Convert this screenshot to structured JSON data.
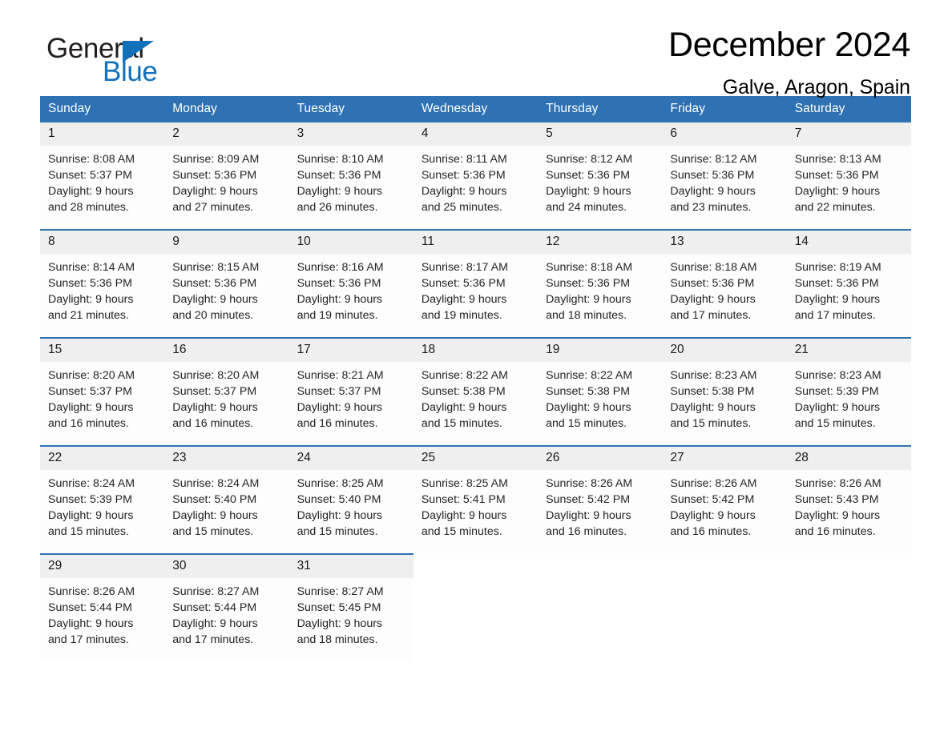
{
  "brand": {
    "word_one": "General",
    "word_two": "Blue",
    "triangle_icon": "triangle-right-icon",
    "accent_color": "#1271bb"
  },
  "header": {
    "title": "December 2024",
    "subtitle": "Galve, Aragon, Spain"
  },
  "theme": {
    "header_blue": "#2e72b3",
    "daynum_gray": "#efefef",
    "text": "#232323"
  },
  "calendar": {
    "weekday_headers": [
      "Sunday",
      "Monday",
      "Tuesday",
      "Wednesday",
      "Thursday",
      "Friday",
      "Saturday"
    ],
    "labels": {
      "sunrise_prefix": "Sunrise:",
      "sunset_prefix": "Sunset:",
      "daylight_prefix": "Daylight:"
    },
    "weeks": [
      [
        {
          "day": "1",
          "sunrise": "Sunrise: 8:08 AM",
          "sunset": "Sunset: 5:37 PM",
          "daylight_line1": "Daylight: 9 hours",
          "daylight_line2": "and 28 minutes."
        },
        {
          "day": "2",
          "sunrise": "Sunrise: 8:09 AM",
          "sunset": "Sunset: 5:36 PM",
          "daylight_line1": "Daylight: 9 hours",
          "daylight_line2": "and 27 minutes."
        },
        {
          "day": "3",
          "sunrise": "Sunrise: 8:10 AM",
          "sunset": "Sunset: 5:36 PM",
          "daylight_line1": "Daylight: 9 hours",
          "daylight_line2": "and 26 minutes."
        },
        {
          "day": "4",
          "sunrise": "Sunrise: 8:11 AM",
          "sunset": "Sunset: 5:36 PM",
          "daylight_line1": "Daylight: 9 hours",
          "daylight_line2": "and 25 minutes."
        },
        {
          "day": "5",
          "sunrise": "Sunrise: 8:12 AM",
          "sunset": "Sunset: 5:36 PM",
          "daylight_line1": "Daylight: 9 hours",
          "daylight_line2": "and 24 minutes."
        },
        {
          "day": "6",
          "sunrise": "Sunrise: 8:12 AM",
          "sunset": "Sunset: 5:36 PM",
          "daylight_line1": "Daylight: 9 hours",
          "daylight_line2": "and 23 minutes."
        },
        {
          "day": "7",
          "sunrise": "Sunrise: 8:13 AM",
          "sunset": "Sunset: 5:36 PM",
          "daylight_line1": "Daylight: 9 hours",
          "daylight_line2": "and 22 minutes."
        }
      ],
      [
        {
          "day": "8",
          "sunrise": "Sunrise: 8:14 AM",
          "sunset": "Sunset: 5:36 PM",
          "daylight_line1": "Daylight: 9 hours",
          "daylight_line2": "and 21 minutes."
        },
        {
          "day": "9",
          "sunrise": "Sunrise: 8:15 AM",
          "sunset": "Sunset: 5:36 PM",
          "daylight_line1": "Daylight: 9 hours",
          "daylight_line2": "and 20 minutes."
        },
        {
          "day": "10",
          "sunrise": "Sunrise: 8:16 AM",
          "sunset": "Sunset: 5:36 PM",
          "daylight_line1": "Daylight: 9 hours",
          "daylight_line2": "and 19 minutes."
        },
        {
          "day": "11",
          "sunrise": "Sunrise: 8:17 AM",
          "sunset": "Sunset: 5:36 PM",
          "daylight_line1": "Daylight: 9 hours",
          "daylight_line2": "and 19 minutes."
        },
        {
          "day": "12",
          "sunrise": "Sunrise: 8:18 AM",
          "sunset": "Sunset: 5:36 PM",
          "daylight_line1": "Daylight: 9 hours",
          "daylight_line2": "and 18 minutes."
        },
        {
          "day": "13",
          "sunrise": "Sunrise: 8:18 AM",
          "sunset": "Sunset: 5:36 PM",
          "daylight_line1": "Daylight: 9 hours",
          "daylight_line2": "and 17 minutes."
        },
        {
          "day": "14",
          "sunrise": "Sunrise: 8:19 AM",
          "sunset": "Sunset: 5:36 PM",
          "daylight_line1": "Daylight: 9 hours",
          "daylight_line2": "and 17 minutes."
        }
      ],
      [
        {
          "day": "15",
          "sunrise": "Sunrise: 8:20 AM",
          "sunset": "Sunset: 5:37 PM",
          "daylight_line1": "Daylight: 9 hours",
          "daylight_line2": "and 16 minutes."
        },
        {
          "day": "16",
          "sunrise": "Sunrise: 8:20 AM",
          "sunset": "Sunset: 5:37 PM",
          "daylight_line1": "Daylight: 9 hours",
          "daylight_line2": "and 16 minutes."
        },
        {
          "day": "17",
          "sunrise": "Sunrise: 8:21 AM",
          "sunset": "Sunset: 5:37 PM",
          "daylight_line1": "Daylight: 9 hours",
          "daylight_line2": "and 16 minutes."
        },
        {
          "day": "18",
          "sunrise": "Sunrise: 8:22 AM",
          "sunset": "Sunset: 5:38 PM",
          "daylight_line1": "Daylight: 9 hours",
          "daylight_line2": "and 15 minutes."
        },
        {
          "day": "19",
          "sunrise": "Sunrise: 8:22 AM",
          "sunset": "Sunset: 5:38 PM",
          "daylight_line1": "Daylight: 9 hours",
          "daylight_line2": "and 15 minutes."
        },
        {
          "day": "20",
          "sunrise": "Sunrise: 8:23 AM",
          "sunset": "Sunset: 5:38 PM",
          "daylight_line1": "Daylight: 9 hours",
          "daylight_line2": "and 15 minutes."
        },
        {
          "day": "21",
          "sunrise": "Sunrise: 8:23 AM",
          "sunset": "Sunset: 5:39 PM",
          "daylight_line1": "Daylight: 9 hours",
          "daylight_line2": "and 15 minutes."
        }
      ],
      [
        {
          "day": "22",
          "sunrise": "Sunrise: 8:24 AM",
          "sunset": "Sunset: 5:39 PM",
          "daylight_line1": "Daylight: 9 hours",
          "daylight_line2": "and 15 minutes."
        },
        {
          "day": "23",
          "sunrise": "Sunrise: 8:24 AM",
          "sunset": "Sunset: 5:40 PM",
          "daylight_line1": "Daylight: 9 hours",
          "daylight_line2": "and 15 minutes."
        },
        {
          "day": "24",
          "sunrise": "Sunrise: 8:25 AM",
          "sunset": "Sunset: 5:40 PM",
          "daylight_line1": "Daylight: 9 hours",
          "daylight_line2": "and 15 minutes."
        },
        {
          "day": "25",
          "sunrise": "Sunrise: 8:25 AM",
          "sunset": "Sunset: 5:41 PM",
          "daylight_line1": "Daylight: 9 hours",
          "daylight_line2": "and 15 minutes."
        },
        {
          "day": "26",
          "sunrise": "Sunrise: 8:26 AM",
          "sunset": "Sunset: 5:42 PM",
          "daylight_line1": "Daylight: 9 hours",
          "daylight_line2": "and 16 minutes."
        },
        {
          "day": "27",
          "sunrise": "Sunrise: 8:26 AM",
          "sunset": "Sunset: 5:42 PM",
          "daylight_line1": "Daylight: 9 hours",
          "daylight_line2": "and 16 minutes."
        },
        {
          "day": "28",
          "sunrise": "Sunrise: 8:26 AM",
          "sunset": "Sunset: 5:43 PM",
          "daylight_line1": "Daylight: 9 hours",
          "daylight_line2": "and 16 minutes."
        }
      ],
      [
        {
          "day": "29",
          "sunrise": "Sunrise: 8:26 AM",
          "sunset": "Sunset: 5:44 PM",
          "daylight_line1": "Daylight: 9 hours",
          "daylight_line2": "and 17 minutes."
        },
        {
          "day": "30",
          "sunrise": "Sunrise: 8:27 AM",
          "sunset": "Sunset: 5:44 PM",
          "daylight_line1": "Daylight: 9 hours",
          "daylight_line2": "and 17 minutes."
        },
        {
          "day": "31",
          "sunrise": "Sunrise: 8:27 AM",
          "sunset": "Sunset: 5:45 PM",
          "daylight_line1": "Daylight: 9 hours",
          "daylight_line2": "and 18 minutes."
        },
        {
          "day": "",
          "sunrise": "",
          "sunset": "",
          "daylight_line1": "",
          "daylight_line2": ""
        },
        {
          "day": "",
          "sunrise": "",
          "sunset": "",
          "daylight_line1": "",
          "daylight_line2": ""
        },
        {
          "day": "",
          "sunrise": "",
          "sunset": "",
          "daylight_line1": "",
          "daylight_line2": ""
        },
        {
          "day": "",
          "sunrise": "",
          "sunset": "",
          "daylight_line1": "",
          "daylight_line2": ""
        }
      ]
    ]
  }
}
